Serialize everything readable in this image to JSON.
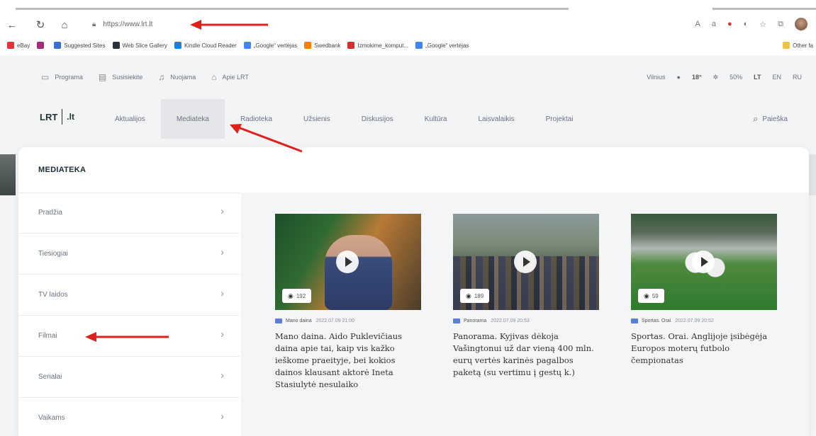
{
  "browser": {
    "url": "https://www.lrt.lt",
    "bookmarks": [
      {
        "label": "eBay",
        "color": "#e53238"
      },
      {
        "label": "Suggested Sites",
        "color": "#3b6fd4"
      },
      {
        "label": "Web Slice Gallery",
        "color": "#2a2f3a"
      },
      {
        "label": "Kindle Cloud Reader",
        "color": "#1e7fd6"
      },
      {
        "label": "„Google“ vertėjas",
        "color": "#4285f4"
      },
      {
        "label": "Swedbank",
        "color": "#ff7f00"
      },
      {
        "label": "Izmokime_komput...",
        "color": "#d62d2d"
      },
      {
        "label": "„Google“ vertėjas",
        "color": "#4285f4"
      }
    ],
    "other_favorites": "Other fa"
  },
  "utility_bar": {
    "items": [
      {
        "icon": "tv-icon",
        "label": "Programa"
      },
      {
        "icon": "document-icon",
        "label": "Susisiekite"
      },
      {
        "icon": "headphones-icon",
        "label": "Nuojama"
      },
      {
        "icon": "home-icon",
        "label": "Apie LRT"
      }
    ],
    "weather_city": "Vilnius",
    "temperature": "18°",
    "humidity": "50%",
    "languages": [
      "LT",
      "EN",
      "RU"
    ]
  },
  "main_nav": {
    "logo": "LRT",
    "logo_suffix": ".lt",
    "items": [
      "Aktualijos",
      "Mediateka",
      "Radioteka",
      "Užsienis",
      "Diskusijos",
      "Kultūra",
      "Laisvalaikis",
      "Projektai"
    ],
    "active": "Mediateka",
    "search_label": "Paieška"
  },
  "mediateka": {
    "title": "MEDIATEKA",
    "sidebar": [
      "Pradžia",
      "Tiesiogiai",
      "TV laidos",
      "Filmai",
      "Serialai",
      "Vaikams"
    ],
    "cards": [
      {
        "views": "192",
        "category": "Mano daina",
        "date": "2022.07.09 21:00",
        "headline": "Mano daina. Aido Puklevičiaus daina apie tai, kaip vis kažko ieškome praeityje, bei kokios dainos klausant aktorė Ineta Stasiulytė nesulaiko"
      },
      {
        "views": "189",
        "category": "Panorama",
        "date": "2022.07.09 20:53",
        "headline": "Panorama. Kyjivas dėkoja Vašingtonui už dar vieną 400 mln. eurų vertės karinės pagalbos paketą (su vertimu į gestų k.)"
      },
      {
        "views": "59",
        "category": "Sportas. Orai",
        "date": "2022.07.09 20:52",
        "headline": "Sportas. Orai. Anglijoje įsibėgėja Europos moterų futbolo čempionatas"
      }
    ]
  },
  "colors": {
    "arrow": "#e0201b",
    "accent": "#5b7fd6"
  }
}
